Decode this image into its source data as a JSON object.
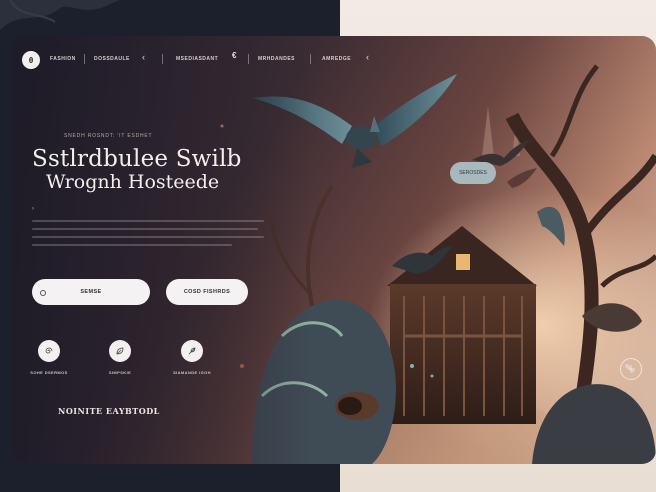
{
  "nav": {
    "logo_text": "θ",
    "items": [
      "FASHION",
      "DOSSDAULE",
      "MSEDIASDANT",
      "MRHDANDES",
      "AMREDGE"
    ]
  },
  "hero": {
    "eyebrow": "SNEDH ROSNDT: 'IT ESDHET",
    "title_line1": "Sstlrdbulee Swilb",
    "title_line2": "Wrognh Hosteede",
    "primary_button": "SEMSE",
    "secondary_button": "COSD FISHRDS",
    "pill_label": "SEROSDES"
  },
  "features": [
    {
      "label": "SOHE DSERMOS",
      "icon": "spiral-icon"
    },
    {
      "label": "SIMPSKIE",
      "icon": "leaf-icon"
    },
    {
      "label": "SIAMANDE IGOH",
      "icon": "feather-icon"
    }
  ],
  "footer": {
    "label": "NOINITE EAYBTODL"
  },
  "colors": {
    "card_dark": "#262433",
    "card_mid": "#6b4540",
    "card_light": "#d9bfae",
    "button_bg": "#f4f2f2",
    "pill_bg": "#a8b9bd"
  }
}
